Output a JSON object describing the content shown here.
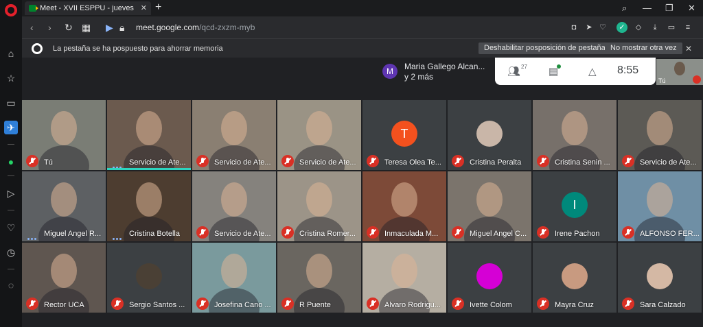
{
  "browser": {
    "tab_title": "Meet - XVII ESPPU - jueves",
    "tab_close": "✕",
    "new_tab": "+",
    "url_host": "meet.google.com",
    "url_path": "/qcd-zxzm-myb"
  },
  "infobar": {
    "message": "La pestaña se ha pospuesto para ahorrar memoria",
    "disable_button": "Deshabilitar posposición de pestañas",
    "dismiss_button": "No mostrar otra vez",
    "close": "✕"
  },
  "meet": {
    "presenter": {
      "avatar_letter": "M",
      "name": "Maria Gallego Alcan...",
      "more": "y 2 más"
    },
    "participants_count": "27",
    "time": "8:55",
    "self_label": "Tú",
    "tiles": [
      {
        "name": "Tú",
        "muted": true,
        "bg": "#7a7d75"
      },
      {
        "name": "Servicio de Ate...",
        "muted": false,
        "bg": "#6b5a4e",
        "speaking_bar": true
      },
      {
        "name": "Servicio de Ate...",
        "muted": true,
        "bg": "#8a7f72"
      },
      {
        "name": "Servicio de Ate...",
        "muted": true,
        "bg": "#9a9385"
      },
      {
        "name": "Teresa Olea Te...",
        "muted": true,
        "bg": "#3c4043",
        "letter": "T",
        "letter_color": "#f4511e"
      },
      {
        "name": "Cristina Peralta",
        "muted": true,
        "bg": "#3c4043",
        "photo": "#c9b6a8"
      },
      {
        "name": "Cristina Senin ...",
        "muted": true,
        "bg": "#77706a"
      },
      {
        "name": "Servicio de Ate...",
        "muted": true,
        "bg": "#5c5a55"
      },
      {
        "name": "Miguel Angel R...",
        "muted": false,
        "bg": "#5d6063"
      },
      {
        "name": "Cristina Botella",
        "muted": false,
        "bg": "#4d3d30"
      },
      {
        "name": "Servicio de Ate...",
        "muted": true,
        "bg": "#85827d"
      },
      {
        "name": "Cristina Romer...",
        "muted": true,
        "bg": "#9c9488"
      },
      {
        "name": "Inmaculada M...",
        "muted": true,
        "bg": "#7d4a38"
      },
      {
        "name": "Miguel Angel C...",
        "muted": true,
        "bg": "#7b746c"
      },
      {
        "name": "Irene Pachon",
        "muted": true,
        "bg": "#3c4043",
        "letter": "I",
        "letter_color": "#00897b"
      },
      {
        "name": "ALFONSO FER...",
        "muted": true,
        "bg": "#6f8fa5"
      },
      {
        "name": "Rector UCA",
        "muted": true,
        "bg": "#5f5650"
      },
      {
        "name": "Sergio Santos ...",
        "muted": true,
        "bg": "#3c4043",
        "photo": "#4a4035"
      },
      {
        "name": "Josefina Cano ...",
        "muted": true,
        "bg": "#7a9a9d"
      },
      {
        "name": "R Puente",
        "muted": true,
        "bg": "#6a6660"
      },
      {
        "name": "Alvaro Rodrigu...",
        "muted": true,
        "bg": "#b5aea2"
      },
      {
        "name": "Ivette Colom",
        "muted": true,
        "bg": "#3c4043",
        "photo": "#d500d5"
      },
      {
        "name": "Mayra Cruz",
        "muted": true,
        "bg": "#3c4043",
        "photo": "#c89a80"
      },
      {
        "name": "Sara Calzado",
        "muted": true,
        "bg": "#3c4043",
        "photo": "#d4b8a4"
      }
    ]
  },
  "colors": {
    "mute": "#d93025",
    "speaking": "#2dd4bf",
    "meet_bg": "#202124"
  }
}
